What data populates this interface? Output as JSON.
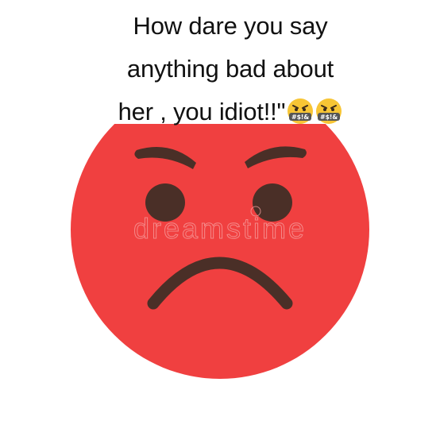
{
  "caption": {
    "line1": "How dare you say",
    "line2": "anything bad about",
    "line3": "her , you idiot!!\""
  },
  "emoji": {
    "names": [
      "face-with-symbols-on-mouth-icon",
      "face-with-symbols-on-mouth-icon"
    ],
    "symbols_text": "#$!&"
  },
  "watermark": {
    "text": "dreamstime"
  },
  "colors": {
    "face_red": "#f04040",
    "features_brown": "#4a2f27",
    "emoji_yellow": "#f7c535",
    "emoji_bar": "#555555"
  }
}
